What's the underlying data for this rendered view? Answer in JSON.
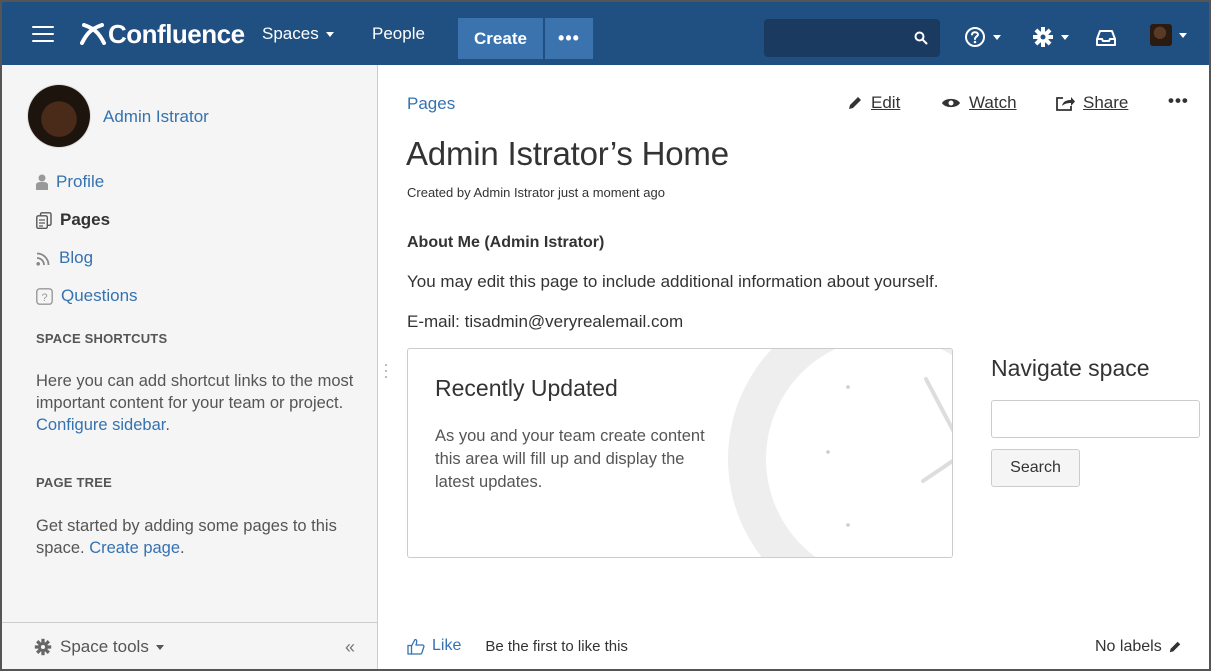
{
  "header": {
    "app_name": "Confluence",
    "nav": {
      "spaces": "Spaces",
      "people": "People"
    },
    "create_label": "Create",
    "more_label": "•••",
    "search_placeholder": "",
    "colors": {
      "bar": "#205081",
      "button": "#3b73af"
    }
  },
  "sidebar": {
    "profile_name": "Admin Istrator",
    "links": {
      "profile": "Profile",
      "pages": "Pages",
      "blog": "Blog",
      "questions": "Questions"
    },
    "shortcuts_heading": "SPACE SHORTCUTS",
    "shortcuts_text": "Here you can add shortcut links to the most important content for your team or project.",
    "configure_link": "Configure sidebar",
    "pagetree_heading": "PAGE TREE",
    "pagetree_text": "Get started by adding some pages to this space.",
    "create_page_link": "Create page",
    "space_tools": "Space tools",
    "collapse": "«"
  },
  "page": {
    "breadcrumb": "Pages",
    "actions": {
      "edit": "Edit",
      "watch": "Watch",
      "share": "Share",
      "more": "•••"
    },
    "title": "Admin Istrator’s Home",
    "meta": "Created by Admin Istrator just a moment ago",
    "about_heading": "About Me (Admin Istrator)",
    "about_text": "You may edit this page to include additional information about yourself.",
    "email_text": "E-mail: tisadmin@veryrealemail.com",
    "recently_updated": {
      "title": "Recently Updated",
      "description": "As you and your team create content this area will fill up and display the latest updates."
    },
    "navigate": {
      "title": "Navigate space",
      "input_value": "",
      "search_button": "Search"
    },
    "like_label": "Like",
    "like_text": "Be the first to like this",
    "labels_text": "No labels"
  }
}
